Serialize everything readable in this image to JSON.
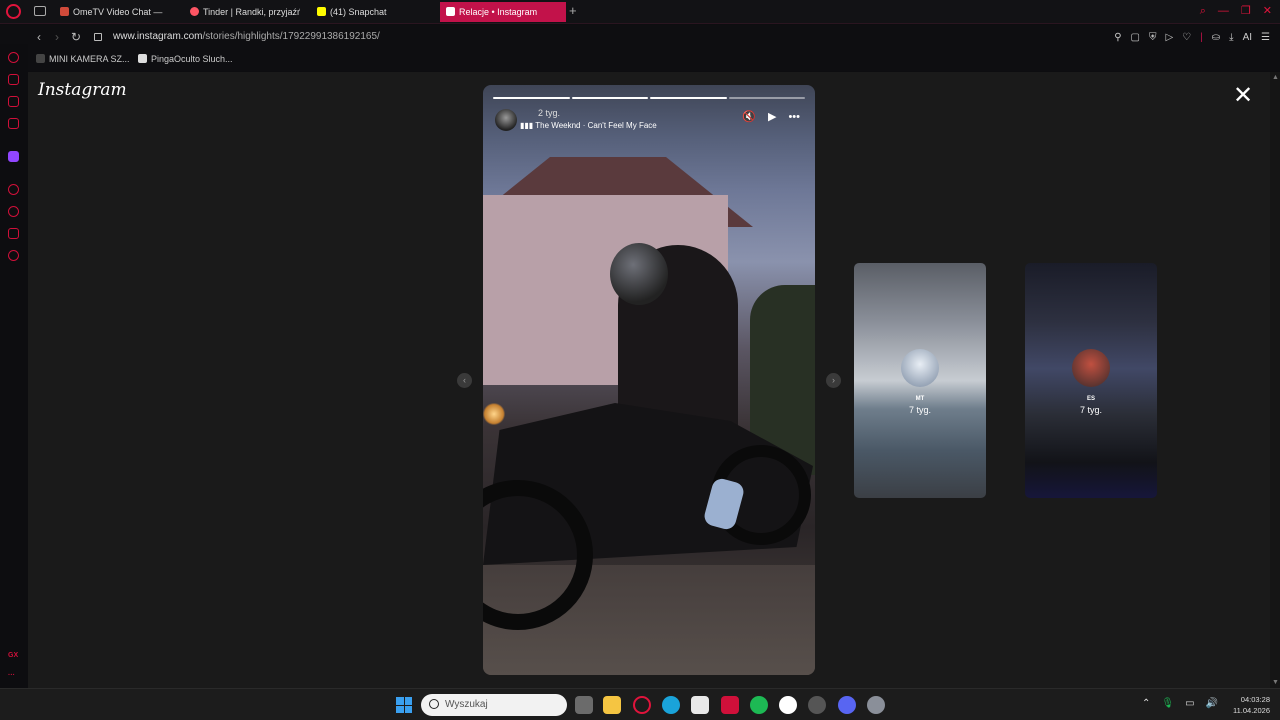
{
  "browser": {
    "tabs": [
      {
        "label": "OmeTV Video Chat —",
        "active": false,
        "favicon_color": "#d04a3a"
      },
      {
        "label": "Tinder | Randki, przyjaźń,",
        "active": false,
        "favicon_color": "#fd5564"
      },
      {
        "label": "(41) Snapchat",
        "active": false,
        "favicon_color": "#fffc00"
      },
      {
        "label": "Relacje • Instagram",
        "active": true,
        "favicon_color": "#e1306c"
      }
    ],
    "url_host": "www.instagram.com",
    "url_path": "/stories/highlights/17922991386192165/",
    "bookmarks": [
      {
        "label": "MINI KAMERA SZ..."
      },
      {
        "label": "PingaOculto Sluch..."
      }
    ],
    "toolbar_ai_label": "AI",
    "sidebar_gx_label": "GX"
  },
  "instagram": {
    "logo_text": "Instagram",
    "story": {
      "time": "2 tyg.",
      "music": "The Weeknd · Can't Feel My Face",
      "progress_total": 4,
      "progress_filled": 3
    },
    "previews": [
      {
        "name": "MT",
        "time": "7 tyg."
      },
      {
        "name": "ES",
        "time": "7 tyg."
      }
    ]
  },
  "taskbar": {
    "search_placeholder": "Wyszukaj",
    "time": "04:03:28",
    "date": "11.04.2026"
  },
  "colors": {
    "opera_red": "#e0143c",
    "active_tab": "#c2124a",
    "viewer_bg": "#1a1a1a"
  }
}
